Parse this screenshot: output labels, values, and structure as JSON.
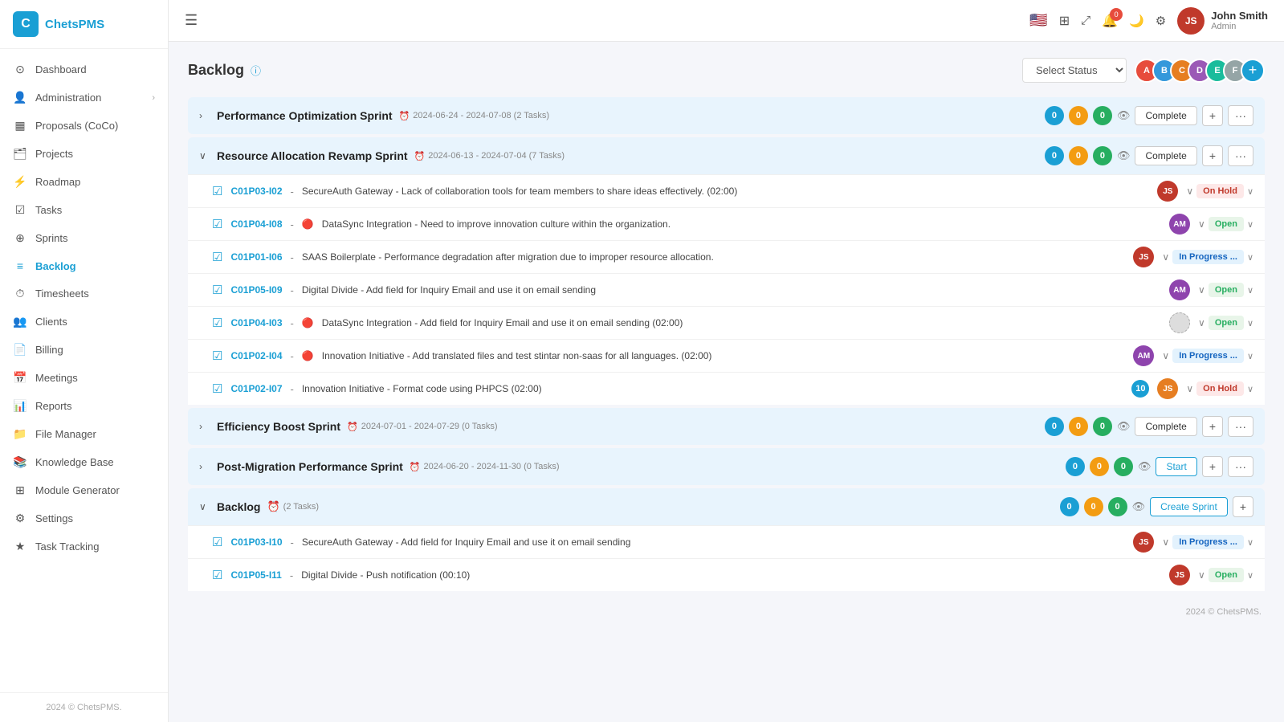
{
  "app": {
    "name": "ChetsPMS",
    "logo_char": "C"
  },
  "header": {
    "menu_icon": "☰",
    "notification_count": "0",
    "user": {
      "name": "John Smith",
      "role": "Admin",
      "initials": "JS"
    }
  },
  "sidebar": {
    "nav_items": [
      {
        "id": "dashboard",
        "label": "Dashboard",
        "icon": "⊙"
      },
      {
        "id": "administration",
        "label": "Administration",
        "icon": "👤",
        "has_arrow": true
      },
      {
        "id": "proposals",
        "label": "Proposals (CoCo)",
        "icon": "▦"
      },
      {
        "id": "projects",
        "label": "Projects",
        "icon": "🗂"
      },
      {
        "id": "roadmap",
        "label": "Roadmap",
        "icon": "⚡"
      },
      {
        "id": "tasks",
        "label": "Tasks",
        "icon": "☑"
      },
      {
        "id": "sprints",
        "label": "Sprints",
        "icon": "⊕"
      },
      {
        "id": "backlog",
        "label": "Backlog",
        "icon": "≡",
        "active": true
      },
      {
        "id": "timesheets",
        "label": "Timesheets",
        "icon": "⏱"
      },
      {
        "id": "clients",
        "label": "Clients",
        "icon": "👥"
      },
      {
        "id": "billing",
        "label": "Billing",
        "icon": "📄"
      },
      {
        "id": "meetings",
        "label": "Meetings",
        "icon": "📅"
      },
      {
        "id": "reports",
        "label": "Reports",
        "icon": "📊"
      },
      {
        "id": "file-manager",
        "label": "File Manager",
        "icon": "📁"
      },
      {
        "id": "knowledge-base",
        "label": "Knowledge Base",
        "icon": "📚"
      },
      {
        "id": "module-generator",
        "label": "Module Generator",
        "icon": "⊞"
      },
      {
        "id": "settings",
        "label": "Settings",
        "icon": "⚙"
      },
      {
        "id": "task-tracking",
        "label": "Task Tracking",
        "icon": "★"
      }
    ],
    "footer": "2024 © ChetsPMS."
  },
  "page": {
    "title": "Backlog",
    "info_icon": "ⓘ",
    "status_placeholder": "Select Status",
    "avatars": [
      {
        "initials": "A",
        "color": "#e74c3c"
      },
      {
        "initials": "B",
        "color": "#3498db"
      },
      {
        "initials": "C",
        "color": "#e67e22"
      },
      {
        "initials": "D",
        "color": "#9b59b6"
      },
      {
        "initials": "E",
        "color": "#1abc9c"
      },
      {
        "initials": "F",
        "color": "#95a5a6"
      }
    ]
  },
  "sprints": [
    {
      "id": "sprint1",
      "name": "Performance Optimization Sprint",
      "date_range": "2024-06-24 - 2024-07-08",
      "task_count": "2 Tasks",
      "expanded": false,
      "badges": [
        0,
        0,
        0
      ],
      "action_label": "Complete",
      "action_type": "complete",
      "tasks": []
    },
    {
      "id": "sprint2",
      "name": "Resource Allocation Revamp Sprint",
      "date_range": "2024-06-13 - 2024-07-04",
      "task_count": "7 Tasks",
      "expanded": true,
      "badges": [
        0,
        0,
        0
      ],
      "action_label": "Complete",
      "action_type": "complete",
      "tasks": [
        {
          "id": "C01P03-I02",
          "text": "SecureAuth Gateway - Lack of collaboration tools for team members to share ideas effectively. (02:00)",
          "priority_icon": "",
          "assignee_initials": "JS",
          "assignee_color": "#c0392b",
          "status": "On Hold",
          "status_class": "status-on-hold",
          "num_badge": null
        },
        {
          "id": "C01P04-I08",
          "text": "DataSync Integration - Need to improve innovation culture within the organization.",
          "priority_icon": "🔴",
          "assignee_initials": "AM",
          "assignee_color": "#8e44ad",
          "status": "Open",
          "status_class": "status-open",
          "num_badge": null
        },
        {
          "id": "C01P01-I06",
          "text": "SAAS Boilerplate - Performance degradation after migration due to improper resource allocation.",
          "priority_icon": "",
          "assignee_initials": "JS",
          "assignee_color": "#c0392b",
          "status": "In Progress ...",
          "status_class": "status-in-progress",
          "num_badge": null
        },
        {
          "id": "C01P05-I09",
          "text": "Digital Divide - Add field for Inquiry Email and use it on email sending",
          "priority_icon": "",
          "assignee_initials": "AM",
          "assignee_color": "#8e44ad",
          "status": "Open",
          "status_class": "status-open",
          "num_badge": null
        },
        {
          "id": "C01P04-I03",
          "text": "DataSync Integration - Add field for Inquiry Email and use it on email sending (02:00)",
          "priority_icon": "🔴",
          "assignee_initials": "",
          "assignee_color": "",
          "status": "Open",
          "status_class": "status-open",
          "num_badge": null
        },
        {
          "id": "C01P02-I04",
          "text": "Innovation Initiative - Add translated files and test stintar non-saas for all languages. (02:00)",
          "priority_icon": "🔴",
          "assignee_initials": "AM",
          "assignee_color": "#8e44ad",
          "status": "In Progress ...",
          "status_class": "status-in-progress",
          "num_badge": null
        },
        {
          "id": "C01P02-I07",
          "text": "Innovation Initiative - Format code using PHPCS (02:00)",
          "priority_icon": "",
          "assignee_initials": "JS",
          "assignee_color": "#e67e22",
          "status": "On Hold",
          "status_class": "status-on-hold",
          "num_badge": "10"
        }
      ]
    },
    {
      "id": "sprint3",
      "name": "Efficiency Boost Sprint",
      "date_range": "2024-07-01 - 2024-07-29",
      "task_count": "0 Tasks",
      "expanded": false,
      "badges": [
        0,
        0,
        0
      ],
      "action_label": "Complete",
      "action_type": "complete",
      "tasks": []
    },
    {
      "id": "sprint4",
      "name": "Post-Migration Performance Sprint",
      "date_range": "2024-06-20 - 2024-11-30",
      "task_count": "0 Tasks",
      "expanded": false,
      "badges": [
        0,
        0,
        0
      ],
      "action_label": "Start",
      "action_type": "start",
      "tasks": []
    },
    {
      "id": "backlog-section",
      "name": "Backlog",
      "date_range": "",
      "task_count": "2 Tasks",
      "expanded": true,
      "badges": [
        0,
        0,
        0
      ],
      "action_label": "Create Sprint",
      "action_type": "create",
      "is_backlog": true,
      "tasks": [
        {
          "id": "C01P03-I10",
          "text": "SecureAuth Gateway - Add field for Inquiry Email and use it on email sending",
          "priority_icon": "",
          "assignee_initials": "JS",
          "assignee_color": "#c0392b",
          "status": "In Progress ...",
          "status_class": "status-in-progress",
          "num_badge": null
        },
        {
          "id": "C01P05-I11",
          "text": "Digital Divide - Push notification (00:10)",
          "priority_icon": "",
          "assignee_initials": "JS",
          "assignee_color": "#c0392b",
          "status": "Open",
          "status_class": "status-open",
          "num_badge": null
        }
      ]
    }
  ],
  "footer": "2024 © ChetsPMS."
}
